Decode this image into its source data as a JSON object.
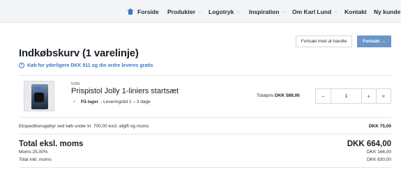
{
  "nav": {
    "items": [
      {
        "label": "Forside",
        "icon": "home-icon",
        "dropdown": false
      },
      {
        "label": "Produkter",
        "dropdown": true
      },
      {
        "label": "Logotryk",
        "dropdown": true
      },
      {
        "label": "Inspiration",
        "dropdown": true
      },
      {
        "label": "Om Karl Lund",
        "dropdown": true
      },
      {
        "label": "Kontakt",
        "dropdown": false
      },
      {
        "label": "Ny kunde",
        "dropdown": false
      }
    ]
  },
  "actions": {
    "continue_shopping": "Fortsæt med at handle",
    "continue": "Fortsæt →"
  },
  "cart": {
    "title": "Indkøbskurv (1 varelinje)",
    "notice": "Køb for yderligere DKK 911 og din ordre leveres gratis"
  },
  "line_item": {
    "sku": "5339",
    "name": "Prispistol Jolly 1-liniers startsæt",
    "stock_status": "På lager",
    "delivery": "- Leveringstid 1 – 3 dage",
    "total_label": "Totalpris",
    "total_value": "DKK 589,00",
    "quantity": "1",
    "minus": "−",
    "plus": "+",
    "remove": "×"
  },
  "summary": {
    "shipping_label": "Ekspeditionsgebyr ved køb under kr. 700,00 excl. afgift og moms",
    "shipping_value": "DKK 75,00",
    "total_excl_label": "Total eksl. moms",
    "total_excl_value": "DKK 664,00",
    "vat_label": "Moms 25,00%",
    "vat_value": "DKK 166,00",
    "total_incl_label": "Total inkl. moms",
    "total_incl_value": "DKK 830,00"
  },
  "colors": {
    "accent": "#3a79c9",
    "primary_button": "#6b96c7",
    "nav_bg": "#f3f4f6"
  }
}
